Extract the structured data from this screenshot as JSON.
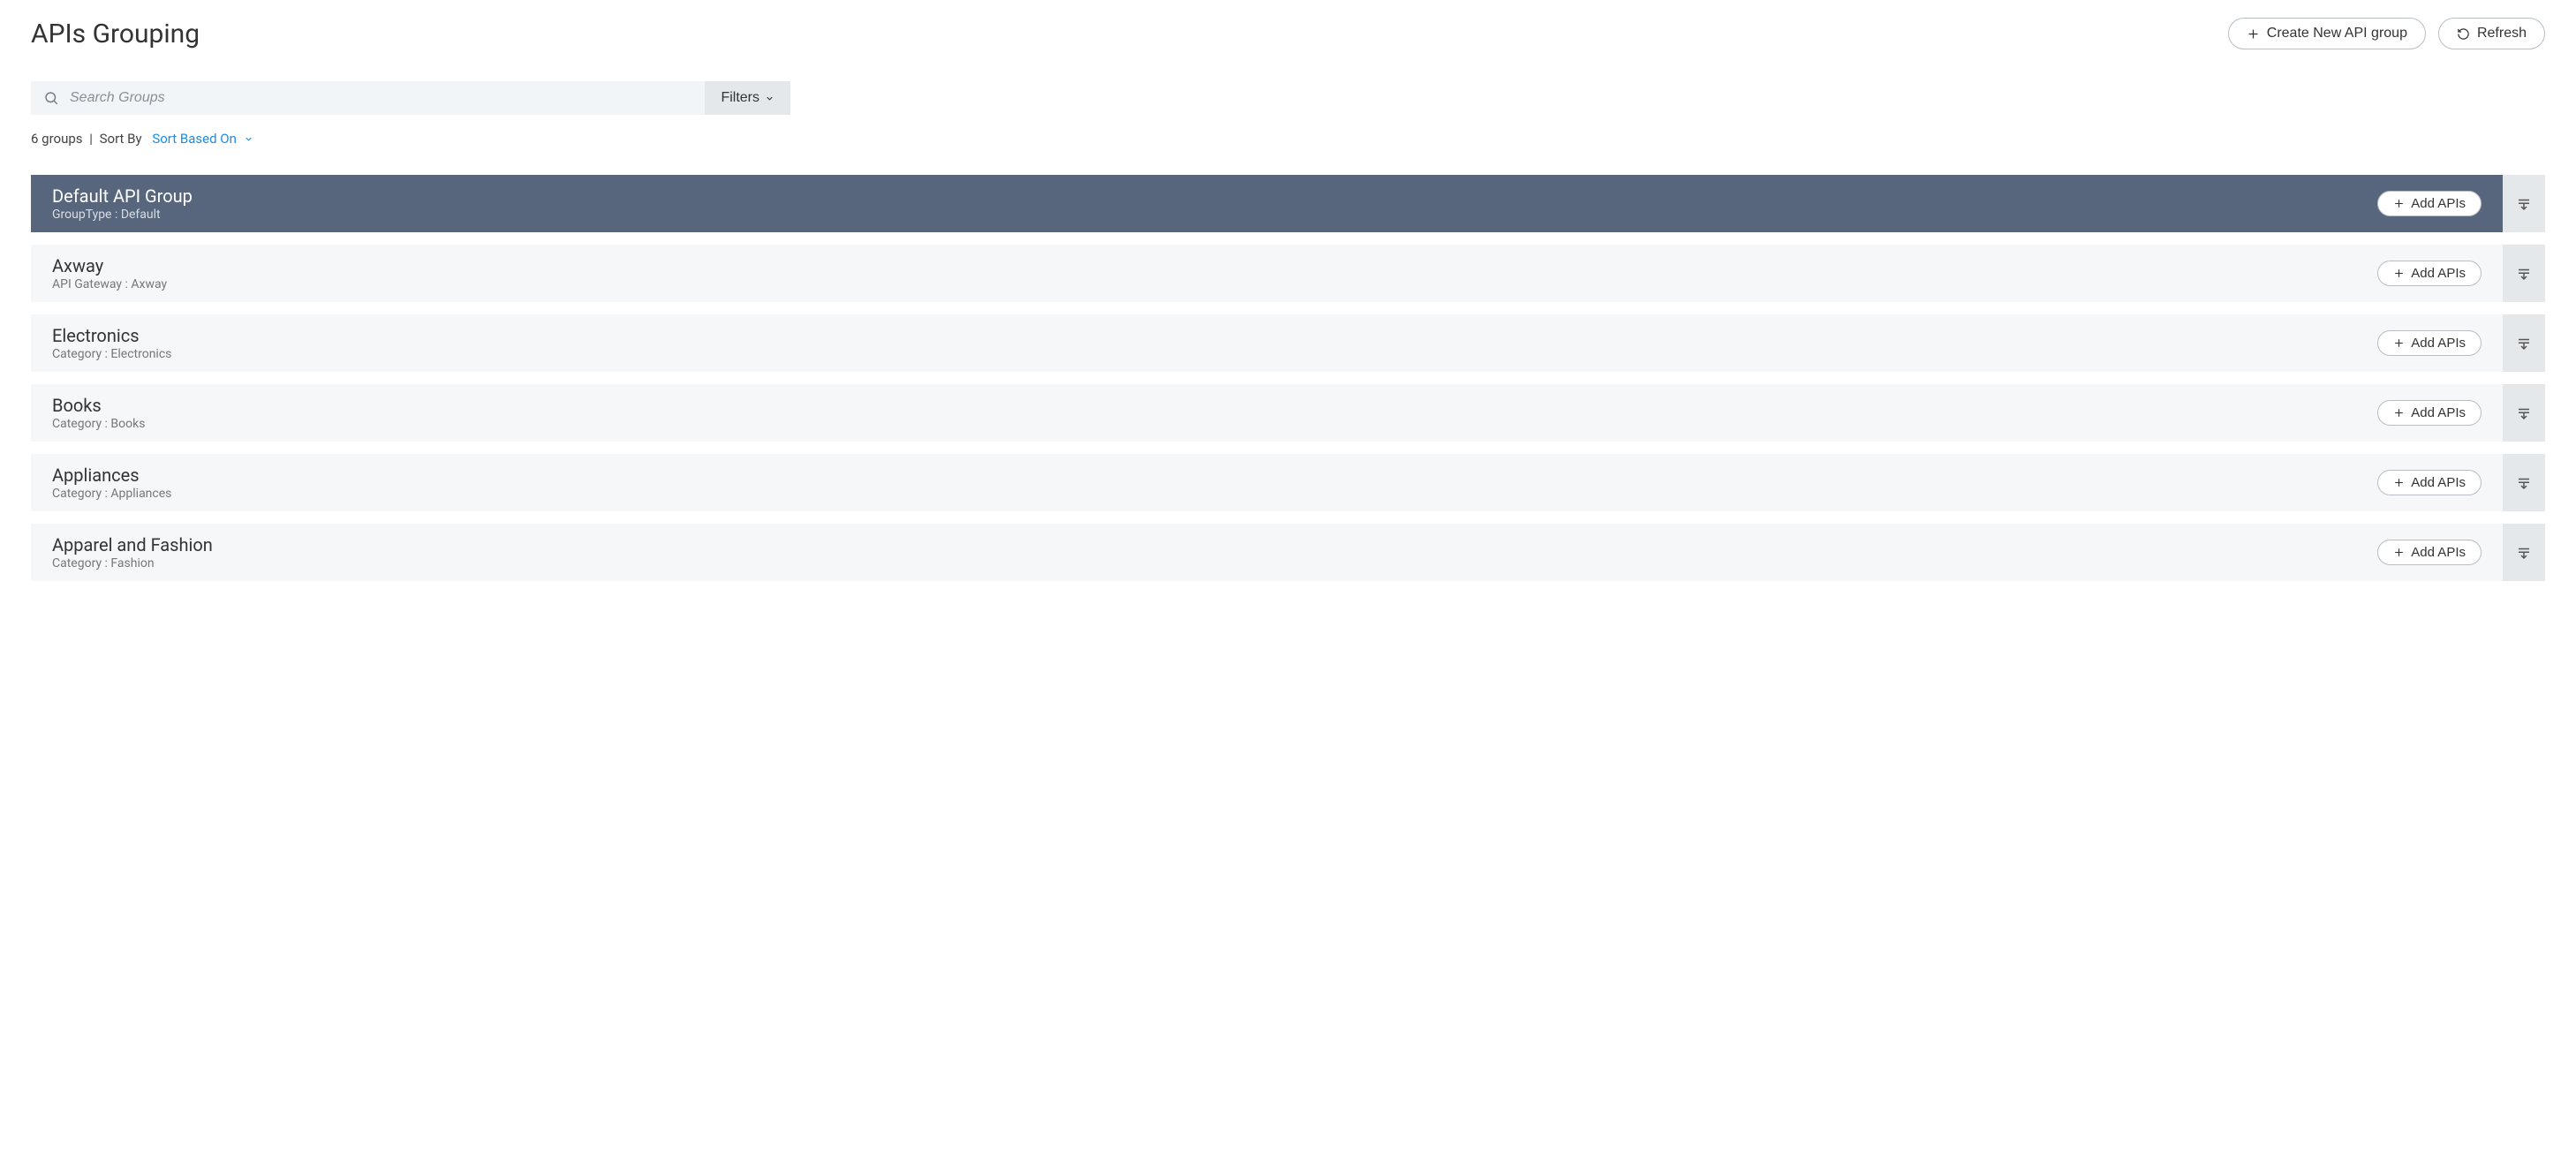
{
  "header": {
    "title": "APIs Grouping",
    "create_label": "Create New API group",
    "refresh_label": "Refresh"
  },
  "search": {
    "placeholder": "Search Groups",
    "filters_label": "Filters"
  },
  "sort": {
    "count_text": "6 groups",
    "sort_by_label": "Sort By",
    "sort_link_label": "Sort Based On"
  },
  "add_apis_label": "Add APIs",
  "groups": [
    {
      "title": "Default API Group",
      "subtitle": "GroupType : Default",
      "selected": true
    },
    {
      "title": "Axway",
      "subtitle": "API Gateway : Axway",
      "selected": false
    },
    {
      "title": "Electronics",
      "subtitle": "Category : Electronics",
      "selected": false
    },
    {
      "title": "Books",
      "subtitle": "Category : Books",
      "selected": false
    },
    {
      "title": "Appliances",
      "subtitle": "Category : Appliances",
      "selected": false
    },
    {
      "title": "Apparel and Fashion",
      "subtitle": "Category : Fashion",
      "selected": false
    }
  ]
}
